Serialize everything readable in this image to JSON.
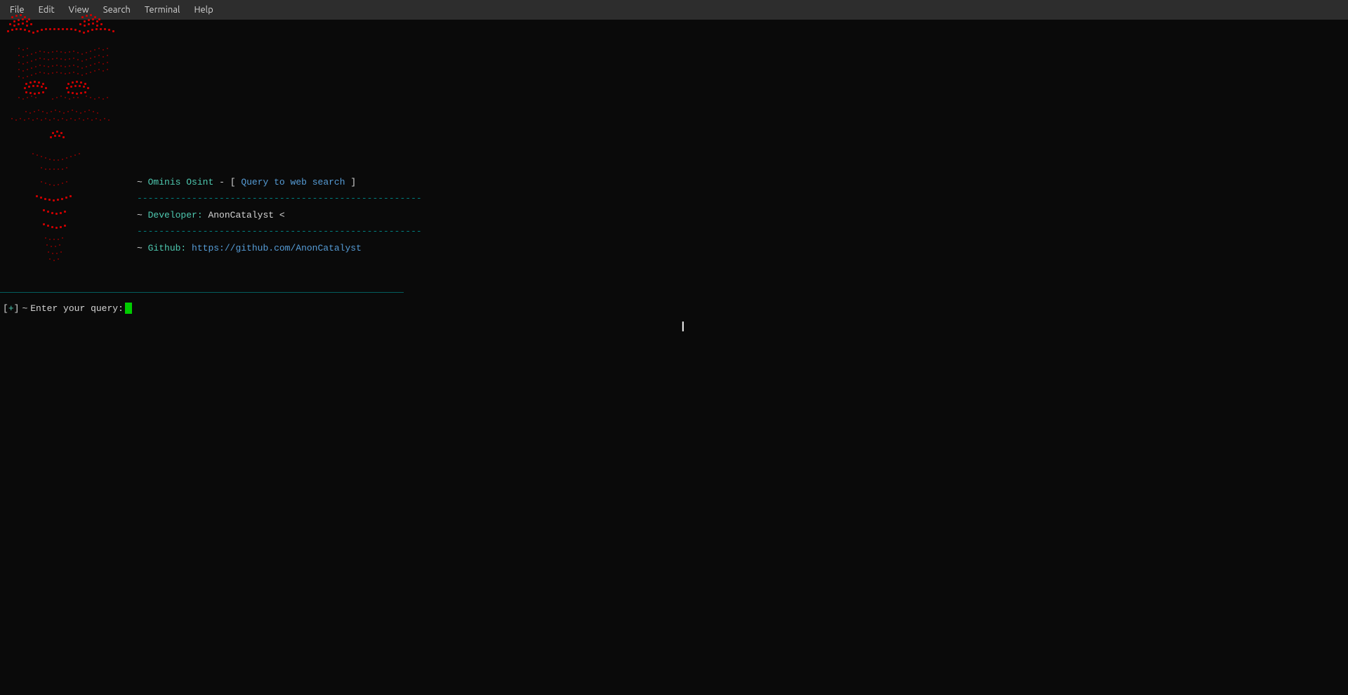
{
  "menubar": {
    "items": [
      "File",
      "Edit",
      "View",
      "Search",
      "Terminal",
      "Help"
    ]
  },
  "ascii_art": {
    "lines": [
      "  ██████████████████████████████████████████████████",
      " ████████████████████████████████████████████████████",
      "  ██████  ██████████████████████████████████  ██████",
      "   █████   ████████████████████████████████   █████",
      "    █████   ██████████████████████████████   █████",
      "     █████   ████████████████████████████   █████",
      "      █████   ██████████████████████████   █████",
      "       █████  ████████████████████████   █████",
      "        ██████  ██████████████████████  ██████",
      "         ███████  ████████████████   ███████",
      "          ████████  ████████████  ████████",
      "           ██████████  ████████  ██████████",
      "            ██████████████████████████████",
      "             ████████████████████████████",
      "              ██████████████████████████",
      "               ████████████████████████",
      "                ██████████████████████",
      "                 ████████████████████",
      "                  ██████████████████"
    ]
  },
  "info": {
    "line1_tilde": "~",
    "line1_tool": "Ominis Osint",
    "line1_dash": "-",
    "line1_bracket_open": "[",
    "line1_query": "Query to web search",
    "line1_bracket_close": "]",
    "separator": "----------------------------------------------------",
    "line2_tilde": "~",
    "line2_label": "Developer:",
    "line2_value": "AnonCatalyst <",
    "line3_tilde": "~",
    "line3_label": "Github:",
    "line3_link": "https://github.com/AnonCatalyst"
  },
  "prompt": {
    "bracket_open": "[",
    "plus": "+",
    "bracket_close": "]",
    "tilde": "~",
    "label": "Enter your query:"
  }
}
